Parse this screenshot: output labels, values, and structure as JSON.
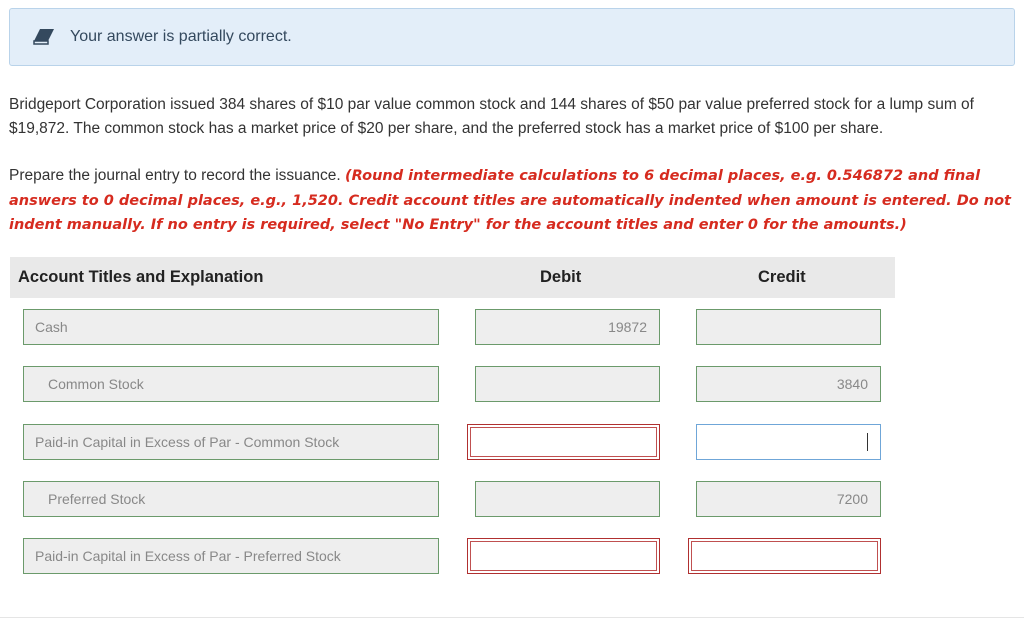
{
  "feedback": {
    "message": "Your answer is partially correct.",
    "icon": "eraser-icon"
  },
  "problem_text": "Bridgeport Corporation issued 384 shares of $10 par value common stock and 144 shares of $50 par value preferred stock for a lump sum of $19,872. The common stock has a market price of $20 per share, and the preferred stock has a market price of $100 per share.",
  "instructions": {
    "lead": "Prepare the journal entry to record the issuance.",
    "note": "(Round intermediate calculations to 6 decimal places, e.g. 0.546872 and final answers to 0 decimal places, e.g., 1,520. Credit account titles are automatically indented when amount is entered. Do not indent manually. If no entry is required, select \"No Entry\" for the account titles and enter 0 for the amounts.)"
  },
  "table": {
    "headers": {
      "account": "Account Titles and Explanation",
      "debit": "Debit",
      "credit": "Credit"
    },
    "rows": [
      {
        "account": "Cash",
        "debit": "19872",
        "credit": ""
      },
      {
        "account": "Common Stock",
        "debit": "",
        "credit": "3840"
      },
      {
        "account": "Paid-in Capital in Excess of Par - Common Stock",
        "debit": "",
        "credit": ""
      },
      {
        "account": "Preferred Stock",
        "debit": "",
        "credit": "7200"
      },
      {
        "account": "Paid-in Capital in Excess of Par - Preferred Stock",
        "debit": "",
        "credit": ""
      }
    ]
  },
  "colors": {
    "banner_bg": "#e3eef9",
    "instruction_red": "#d62b1f",
    "correct_border": "#6b9a6b",
    "error_border": "#b03030",
    "focus_border": "#6fa6d8"
  }
}
